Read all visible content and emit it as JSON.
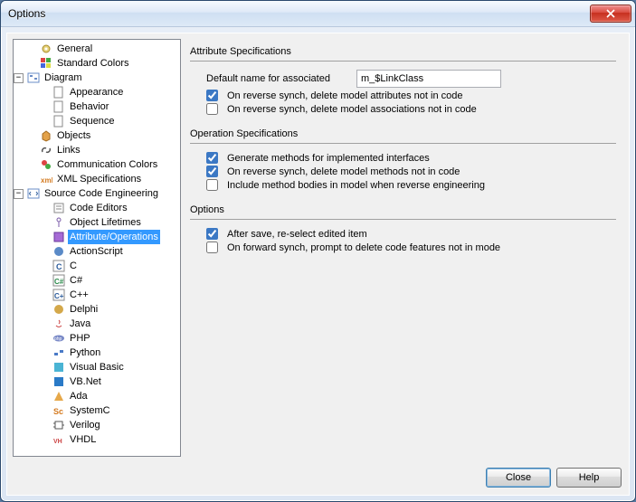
{
  "window": {
    "title": "Options"
  },
  "tree": {
    "general": "General",
    "standard_colors": "Standard Colors",
    "diagram": "Diagram",
    "appearance": "Appearance",
    "behavior": "Behavior",
    "sequence": "Sequence",
    "objects": "Objects",
    "links": "Links",
    "comm_colors": "Communication Colors",
    "xml_specs": "XML Specifications",
    "src_eng": "Source Code Engineering",
    "code_editors": "Code Editors",
    "obj_lifetimes": "Object Lifetimes",
    "attr_ops": "Attribute/Operations",
    "actionscript": "ActionScript",
    "c": "C",
    "csharp": "C#",
    "cpp": "C++",
    "delphi": "Delphi",
    "java": "Java",
    "php": "PHP",
    "python": "Python",
    "vb": "Visual Basic",
    "vbnet": "VB.Net",
    "ada": "Ada",
    "systemc": "SystemC",
    "verilog": "Verilog",
    "vhdl": "VHDL"
  },
  "groups": {
    "attr_spec": "Attribute Specifications",
    "op_spec": "Operation Specifications",
    "options": "Options"
  },
  "fields": {
    "default_name_label": "Default name for associated",
    "default_name_value": "m_$LinkClass",
    "rev_del_attrs": "On reverse synch, delete model attributes not in code",
    "rev_del_assocs": "On reverse synch, delete model associations not in code",
    "gen_methods": "Generate methods for implemented interfaces",
    "rev_del_methods": "On reverse synch, delete model methods not in code",
    "include_bodies": "Include method bodies in model when reverse engineering",
    "after_save": "After save, re-select edited item",
    "fwd_prompt": "On forward synch, prompt to delete code features not in mode"
  },
  "checks": {
    "rev_del_attrs": true,
    "rev_del_assocs": false,
    "gen_methods": true,
    "rev_del_methods": true,
    "include_bodies": false,
    "after_save": true,
    "fwd_prompt": false
  },
  "buttons": {
    "close": "Close",
    "help": "Help"
  },
  "colors": {
    "selection": "#3399ff"
  }
}
